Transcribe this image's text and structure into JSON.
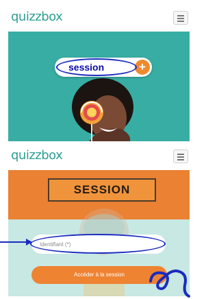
{
  "top_view": {
    "logo": "quizzbox",
    "menu_icon": "hamburger-icon",
    "session_pill": {
      "label": "session",
      "plus_label": "+"
    }
  },
  "bottom_view": {
    "logo": "quizzbox",
    "menu_icon": "hamburger-icon",
    "session_title": "SESSION",
    "identifier_input": {
      "placeholder": "Identifiant (*)",
      "value": ""
    },
    "access_button": {
      "label": "Accéder à la session"
    }
  },
  "colors": {
    "brand_teal": "#2e9e94",
    "hero_teal": "#38ada4",
    "accent_orange": "#ee8332",
    "annotation_blue": "#1a2bbf",
    "panel_mint": "#c7e8e3"
  }
}
